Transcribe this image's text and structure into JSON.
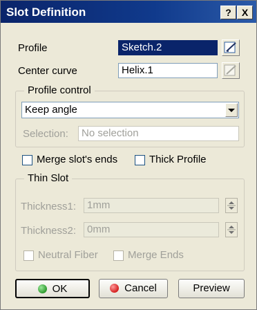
{
  "window": {
    "title": "Slot Definition",
    "help_label": "?",
    "close_label": "X"
  },
  "profile": {
    "label": "Profile",
    "value": "Sketch.2"
  },
  "center_curve": {
    "label": "Center curve",
    "value": "Helix.1"
  },
  "profile_control": {
    "legend": "Profile control",
    "mode_value": "Keep angle",
    "selection_label": "Selection:",
    "selection_value": "No selection"
  },
  "options": {
    "merge_label": "Merge slot's ends",
    "thick_label": "Thick Profile"
  },
  "thin_slot": {
    "legend": "Thin Slot",
    "thickness1_label": "Thickness1:",
    "thickness1_value": "1mm",
    "thickness2_label": "Thickness2:",
    "thickness2_value": "0mm",
    "neutral_label": "Neutral Fiber",
    "merge_ends_label": "Merge Ends"
  },
  "buttons": {
    "ok_label": "OK",
    "cancel_label": "Cancel",
    "preview_label": "Preview"
  },
  "colors": {
    "title_bg": "#0a246a",
    "dialog_bg": "#ece9d8",
    "ok_dot": "#2e9a2e",
    "cancel_dot": "#d42020"
  }
}
